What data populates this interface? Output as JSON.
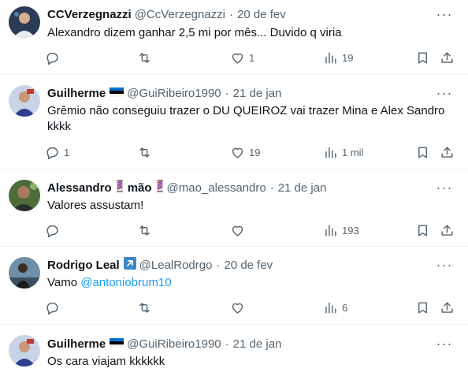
{
  "tweets": [
    {
      "name": "CCVerzegnazzi",
      "handle": "@CcVerzegnazzi",
      "date": "20 de fev",
      "text": "Alexandro dizem ganhar 2,5 mi por mês... Duvido q viria",
      "replies": "",
      "retweets": "",
      "likes": "1",
      "views": "19"
    },
    {
      "name": "Guilherme",
      "handle": "@GuiRibeiro1990",
      "date": "21 de jan",
      "text": "Grêmio não conseguiu trazer o DU QUEIROZ vai trazer Mina e Alex Sandro kkkk",
      "replies": "1",
      "retweets": "",
      "likes": "19",
      "views": "1 mil"
    },
    {
      "name": "Alessandro",
      "name_suffix": "mão",
      "handle": "@mao_alessandro",
      "date": "21 de jan",
      "text": "Valores assustam!",
      "replies": "",
      "retweets": "",
      "likes": "",
      "views": "193"
    },
    {
      "name": "Rodrigo Leal",
      "handle": "@LealRodrgo",
      "date": "20 de fev",
      "text": "Vamo ",
      "mention": "@antoniobrum10",
      "replies": "",
      "retweets": "",
      "likes": "",
      "views": "6"
    },
    {
      "name": "Guilherme",
      "handle": "@GuiRibeiro1990",
      "date": "21 de jan",
      "text": "Os cara viajam kkkkkk",
      "replies": "",
      "retweets": "",
      "likes": "",
      "views": ""
    }
  ],
  "colors": {
    "text": "#0f1419",
    "secondary": "#536471",
    "link": "#1d9bf0",
    "divider": "#eff3f4"
  },
  "icons": [
    "reply-icon",
    "retweet-icon",
    "like-icon",
    "views-icon",
    "bookmark-icon",
    "share-icon",
    "more-icon",
    "estonia-flag-icon",
    "barber-pole-icon",
    "arrow-up-right-icon"
  ]
}
